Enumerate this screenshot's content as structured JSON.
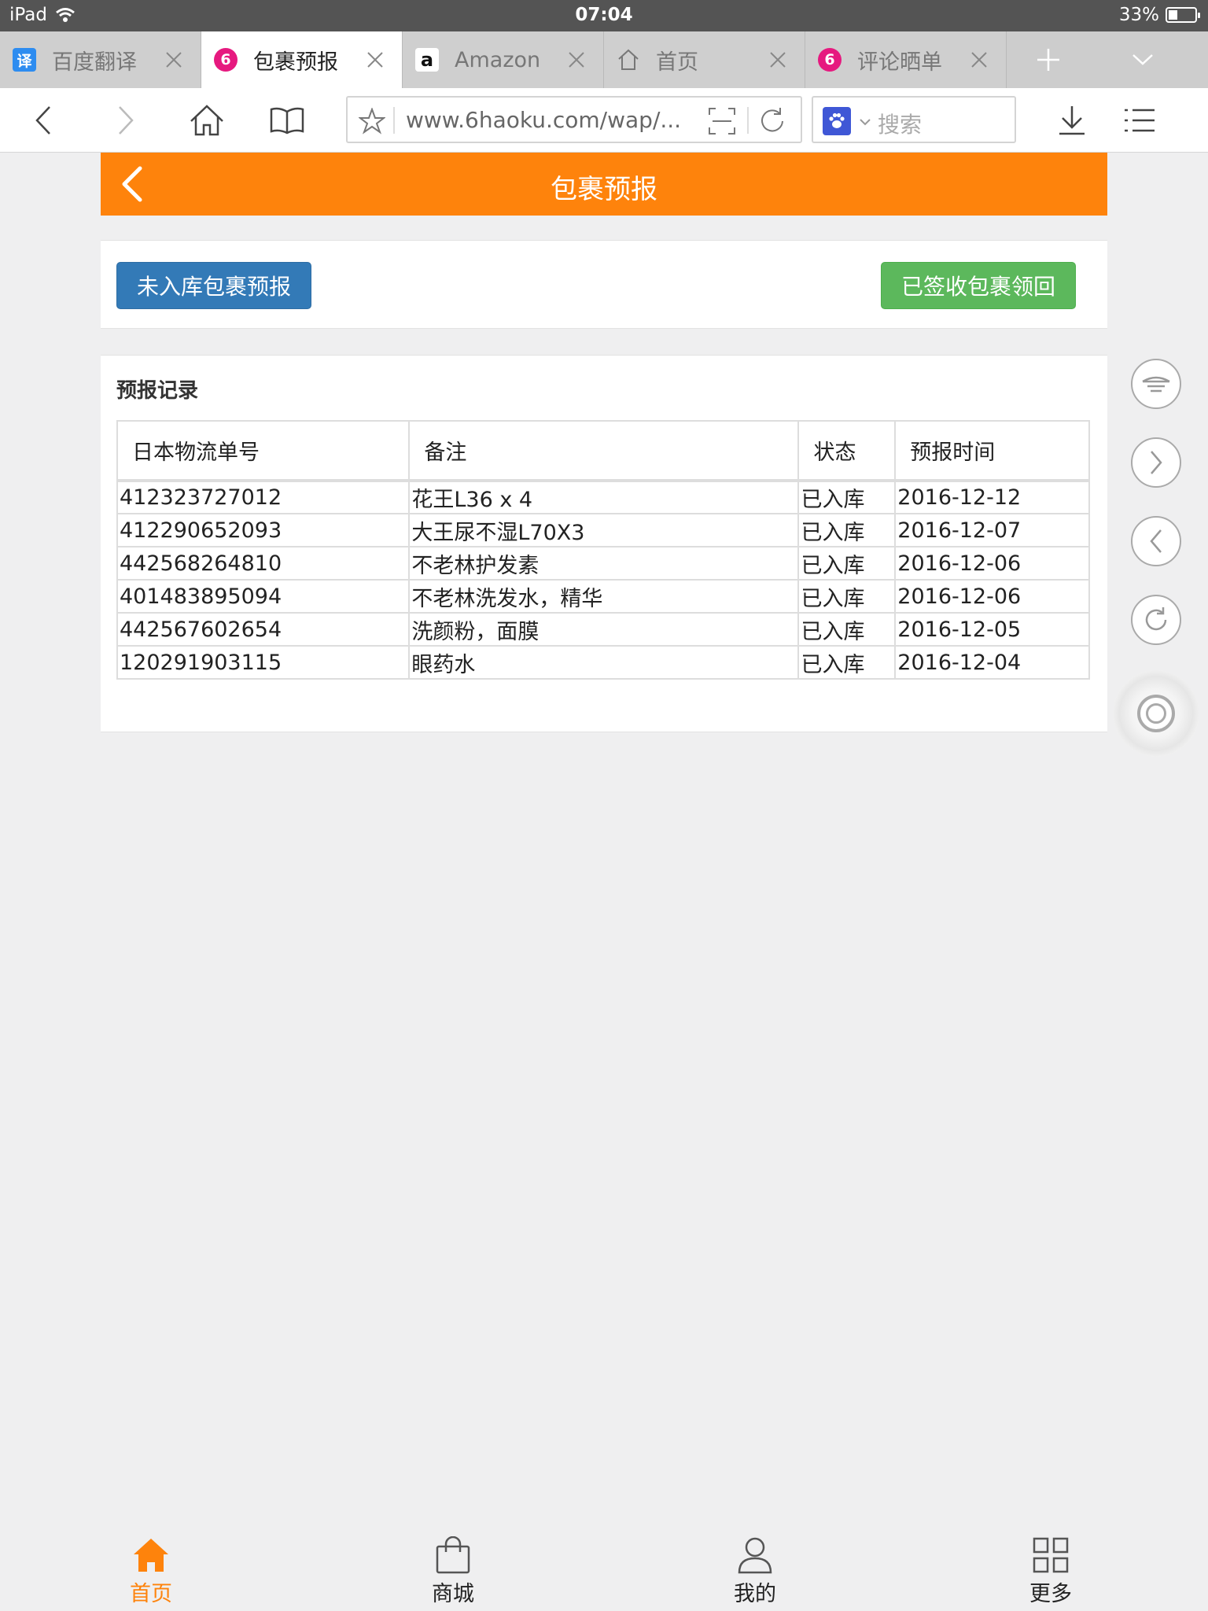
{
  "status_bar": {
    "device": "iPad",
    "time": "07:04",
    "battery": "33%",
    "battery_level": 0.33
  },
  "tabs": [
    {
      "label": "百度翻译",
      "favicon": "译",
      "favicon_color": "#2d8cf0",
      "active": false
    },
    {
      "label": "包裹预报",
      "favicon": "6",
      "favicon_color": "#e6197f",
      "active": true
    },
    {
      "label": "Amazon",
      "favicon": "a",
      "favicon_color": "#ffffff",
      "active": false
    },
    {
      "label": "首页",
      "favicon": "home-icon",
      "active": false
    },
    {
      "label": "评论晒单",
      "favicon": "6",
      "favicon_color": "#e6197f",
      "active": false
    }
  ],
  "toolbar": {
    "url": "www.6haoku.com/wap/...",
    "search_placeholder": "搜索"
  },
  "page": {
    "title": "包裹预报",
    "header_color": "#fe830c",
    "buttons": {
      "unstocked_forecast": "未入库包裹预报",
      "signed_return": "已签收包裹领回"
    },
    "records": {
      "title": "预报记录",
      "columns": [
        "日本物流单号",
        "备注",
        "状态",
        "预报时间"
      ],
      "rows": [
        [
          "412323727012",
          "花王L36 x 4",
          "已入库",
          "2016-12-12"
        ],
        [
          "412290652093",
          "大王尿不湿L70X3",
          "已入库",
          "2016-12-07"
        ],
        [
          "442568264810",
          "不老林护发素",
          "已入库",
          "2016-12-06"
        ],
        [
          "401483895094",
          "不老林洗发水，精华",
          "已入库",
          "2016-12-06"
        ],
        [
          "442567602654",
          "洗颜粉，面膜",
          "已入库",
          "2016-12-05"
        ],
        [
          "120291903115",
          "眼药水",
          "已入库",
          "2016-12-04"
        ]
      ]
    }
  },
  "bottom_nav": [
    {
      "label": "首页",
      "icon": "home-icon",
      "active": true
    },
    {
      "label": "商城",
      "icon": "shopping-bag-icon",
      "active": false
    },
    {
      "label": "我的",
      "icon": "user-icon",
      "active": false
    },
    {
      "label": "更多",
      "icon": "grid-icon",
      "active": false
    }
  ]
}
